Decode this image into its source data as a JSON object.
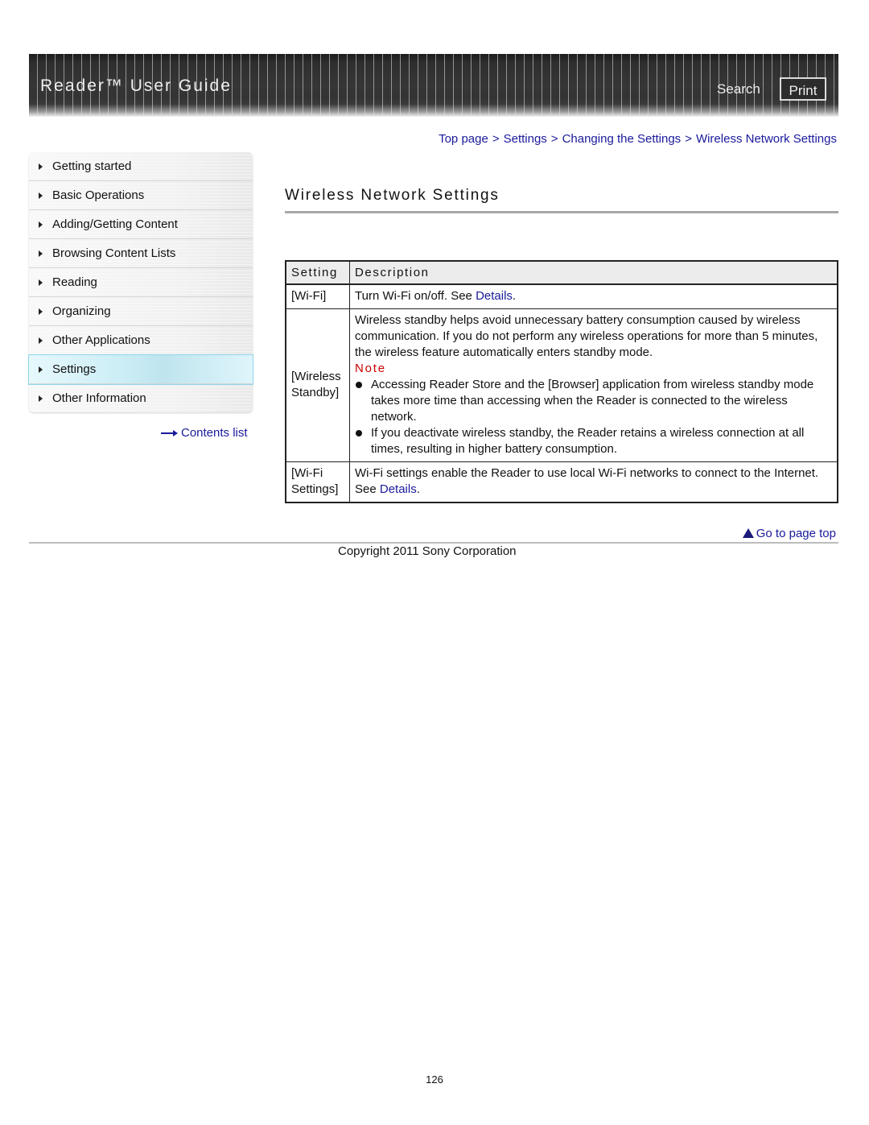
{
  "header": {
    "title": "Reader™ User Guide",
    "search_label": "Search",
    "print_label": "Print"
  },
  "sidebar": {
    "items": [
      {
        "label": "Getting started",
        "active": false
      },
      {
        "label": "Basic Operations",
        "active": false
      },
      {
        "label": "Adding/Getting Content",
        "active": false
      },
      {
        "label": "Browsing Content Lists",
        "active": false
      },
      {
        "label": "Reading",
        "active": false
      },
      {
        "label": "Organizing",
        "active": false
      },
      {
        "label": "Other Applications",
        "active": false
      },
      {
        "label": "Settings",
        "active": true
      },
      {
        "label": "Other Information",
        "active": false
      }
    ],
    "contents_link": "Contents list"
  },
  "breadcrumb": {
    "items": [
      "Top page",
      "Settings",
      "Changing the Settings",
      "Wireless Network Settings"
    ],
    "separator": ">"
  },
  "page": {
    "title": "Wireless Network Settings"
  },
  "table": {
    "headers": [
      "Setting",
      "Description"
    ],
    "rows": [
      {
        "setting": "[Wi-Fi]",
        "desc_before": "Turn Wi-Fi on/off. See ",
        "link": "Details",
        "desc_after": "."
      },
      {
        "setting": "[Wireless Standby]",
        "desc": "Wireless standby helps avoid unnecessary battery consumption caused by wireless communication. If you do not perform any wireless operations for more than 5 minutes, the wireless feature automatically enters standby mode.",
        "note_label": "Note",
        "notes": [
          "Accessing Reader Store and the [Browser] application from wireless standby mode takes more time than accessing when the Reader is connected to the wireless network.",
          "If you deactivate wireless standby, the Reader retains a wireless connection at all times, resulting in higher battery consumption."
        ]
      },
      {
        "setting": "[Wi-Fi Settings]",
        "desc_before": "Wi-Fi settings enable the Reader to use local Wi-Fi networks to connect to the Internet. See ",
        "link": "Details",
        "desc_after": "."
      }
    ]
  },
  "footer": {
    "go_to_top": "Go to page top",
    "copyright": "Copyright 2011 Sony Corporation",
    "page_number": "126"
  },
  "colors": {
    "link": "#1a1a9c",
    "note": "#cc0000",
    "active_nav": "#cdeef6",
    "banner": "#333333"
  }
}
